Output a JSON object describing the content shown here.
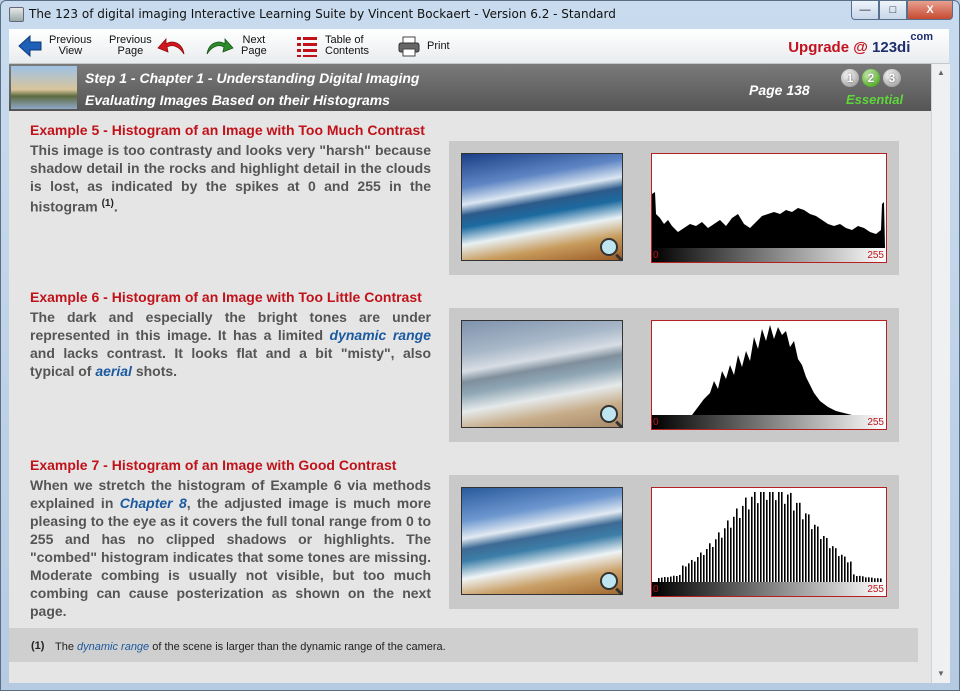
{
  "window": {
    "title": "The 123 of digital imaging Interactive Learning Suite by Vincent Bockaert - Version 6.2 - Standard",
    "controls": {
      "minimize": "—",
      "maximize": "□",
      "close": "X"
    }
  },
  "toolbar": {
    "previous_view": [
      "Previous",
      "View"
    ],
    "previous_page": [
      "Previous",
      "Page"
    ],
    "next_page": [
      "Next",
      "Page"
    ],
    "toc": [
      "Table of",
      "Contents"
    ],
    "print": "Print",
    "upgrade_prefix": "Upgrade @ ",
    "upgrade_brand": "123di",
    "upgrade_sup": "com"
  },
  "header": {
    "chapter": "Step 1 - Chapter 1 - Understanding Digital Imaging",
    "topic": "Evaluating Images Based on their Histograms",
    "page": "Page 138",
    "levels": [
      "1",
      "2",
      "3"
    ],
    "level_active": 2,
    "level_label": "Essential"
  },
  "examples": [
    {
      "title": "Example 5 - Histogram of an Image with Too Much Contrast",
      "body_parts": [
        "This image is too contrasty and looks very \"harsh\" because shadow detail in the rocks and highlight detail in the clouds is lost, as indicated by the spikes at 0 and 255 in the histogram "
      ],
      "footnote_ref": "(1)",
      "body_end": "."
    },
    {
      "title": "Example 6 - Histogram of an Image with Too Little Contrast",
      "p1": "The dark and especially the bright tones are under represented in this image. It has a limited ",
      "link1": "dynamic range",
      "p2": " and lacks contrast. It looks flat and a bit \"misty\", also typical of ",
      "link2": "aerial",
      "p3": " shots."
    },
    {
      "title": "Example 7 - Histogram of an Image with Good Contrast",
      "p1": "When we stretch the histogram of Example 6 via methods explained in ",
      "link1": "Chapter 8",
      "p2": ", the adjusted image is much more pleasing to the eye as it covers the full tonal range from 0 to 255 and has no clipped shadows or highlights. The \"combed\" histogram indicates that some tones are missing. Moderate combing is usually not visible, but too much combing can cause posterization as shown on the next page."
    }
  ],
  "histogram": {
    "min_label": "0",
    "max_label": "255"
  },
  "footnote": {
    "num": "(1)",
    "pre": "The ",
    "link": "dynamic range",
    "post": " of the scene is larger than the dynamic range of the camera."
  },
  "colors": {
    "accent_red": "#c1121a",
    "link_blue": "#1c5aa0",
    "essential_green": "#5fd63a"
  }
}
